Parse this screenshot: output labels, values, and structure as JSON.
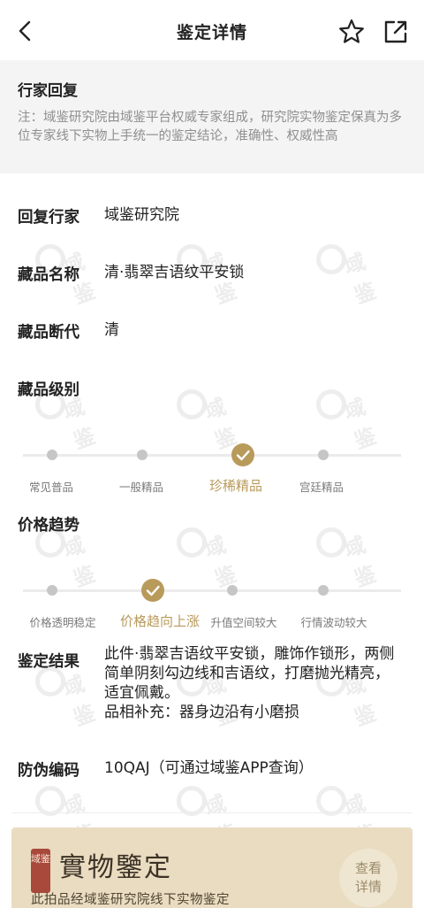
{
  "header": {
    "title": "鉴定详情"
  },
  "notice": {
    "title": "行家回复",
    "text": "注：域鉴研究院由域鉴平台权威专家组成，研究院实物鉴定保真为多位专家线下实物上手统一的鉴定结论，准确性、权威性高"
  },
  "details": {
    "expert_label": "回复行家",
    "expert_value": "域鉴研究院",
    "name_label": "藏品名称",
    "name_value": "清·翡翠吉语纹平安锁",
    "era_label": "藏品断代",
    "era_value": "清",
    "level_label": "藏品级别",
    "trend_label": "价格趋势",
    "result_label": "鉴定结果",
    "result_value": "此件·翡翠吉语纹平安锁，雕饰作锁形，两侧简单阴刻勾边线和吉语纹，打磨抛光精亮，适宜佩戴。",
    "result_extra": "品相补充：器身边沿有小磨损",
    "code_label": "防伪编码",
    "code_value": "10QAJ（可通过域鉴APP查询）"
  },
  "level": {
    "options": [
      "常见普品",
      "一般精品",
      "珍稀精品",
      "宫廷精品"
    ],
    "selected_index": 2
  },
  "trend": {
    "options": [
      "价格透明稳定",
      "价格趋向上涨",
      "升值空间较大",
      "行情波动较大"
    ],
    "selected_index": 1
  },
  "banner": {
    "seal_text": "域鉴",
    "title": "實物鑒定",
    "subtitle": "此拍品经域鉴研究院线下实物鉴定",
    "button_line1": "查看",
    "button_line2": "详情"
  },
  "watermark": {
    "text": "域鉴"
  },
  "colors": {
    "accent": "#b89a5b",
    "notice_bg": "#f4f4f4",
    "banner_bg": "#e9dcc1"
  }
}
